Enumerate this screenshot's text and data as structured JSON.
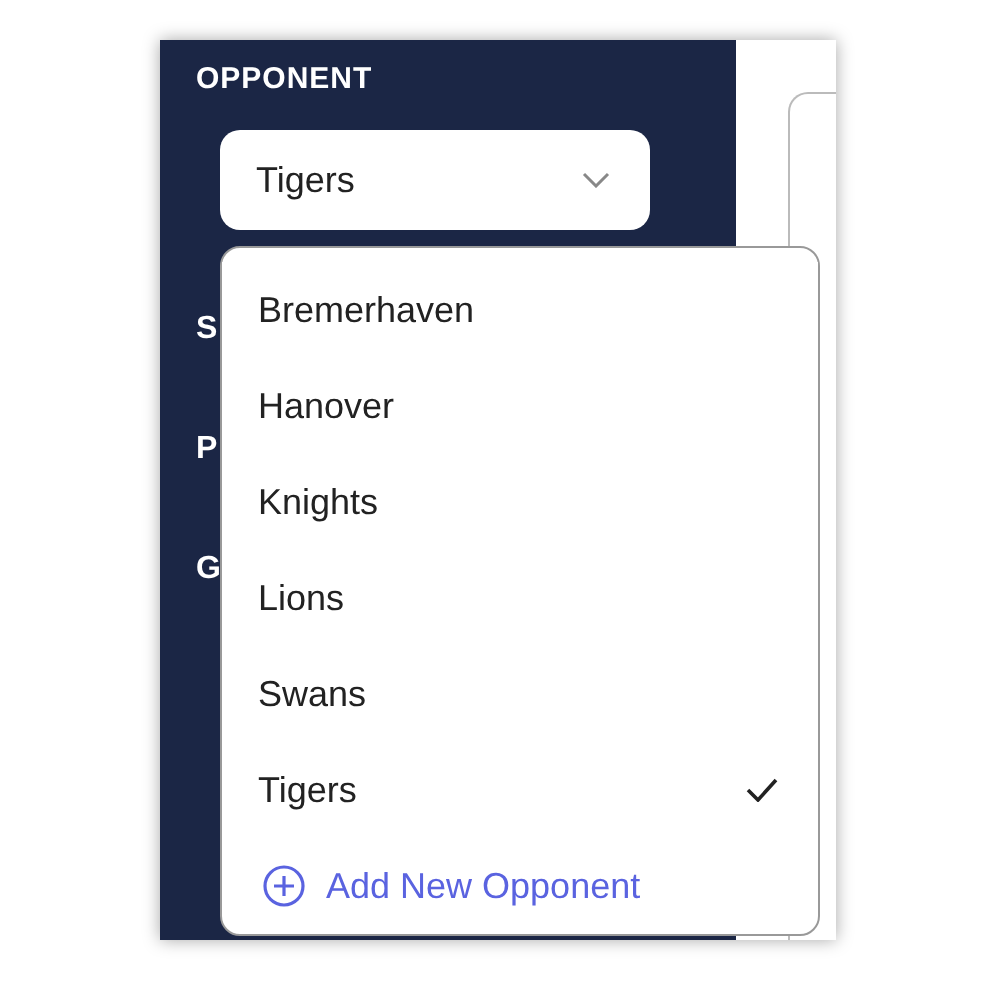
{
  "sidebar": {
    "heading": "OPPONENT",
    "select": {
      "value": "Tigers",
      "expanded": true
    },
    "hidden_labels": [
      "S",
      "P",
      "G"
    ]
  },
  "menu": {
    "options": [
      {
        "label": "Bremerhaven",
        "selected": false
      },
      {
        "label": "Hanover",
        "selected": false
      },
      {
        "label": "Knights",
        "selected": false
      },
      {
        "label": "Lions",
        "selected": false
      },
      {
        "label": "Swans",
        "selected": false
      },
      {
        "label": "Tigers",
        "selected": true
      }
    ],
    "add_action": "Add New Opponent"
  }
}
